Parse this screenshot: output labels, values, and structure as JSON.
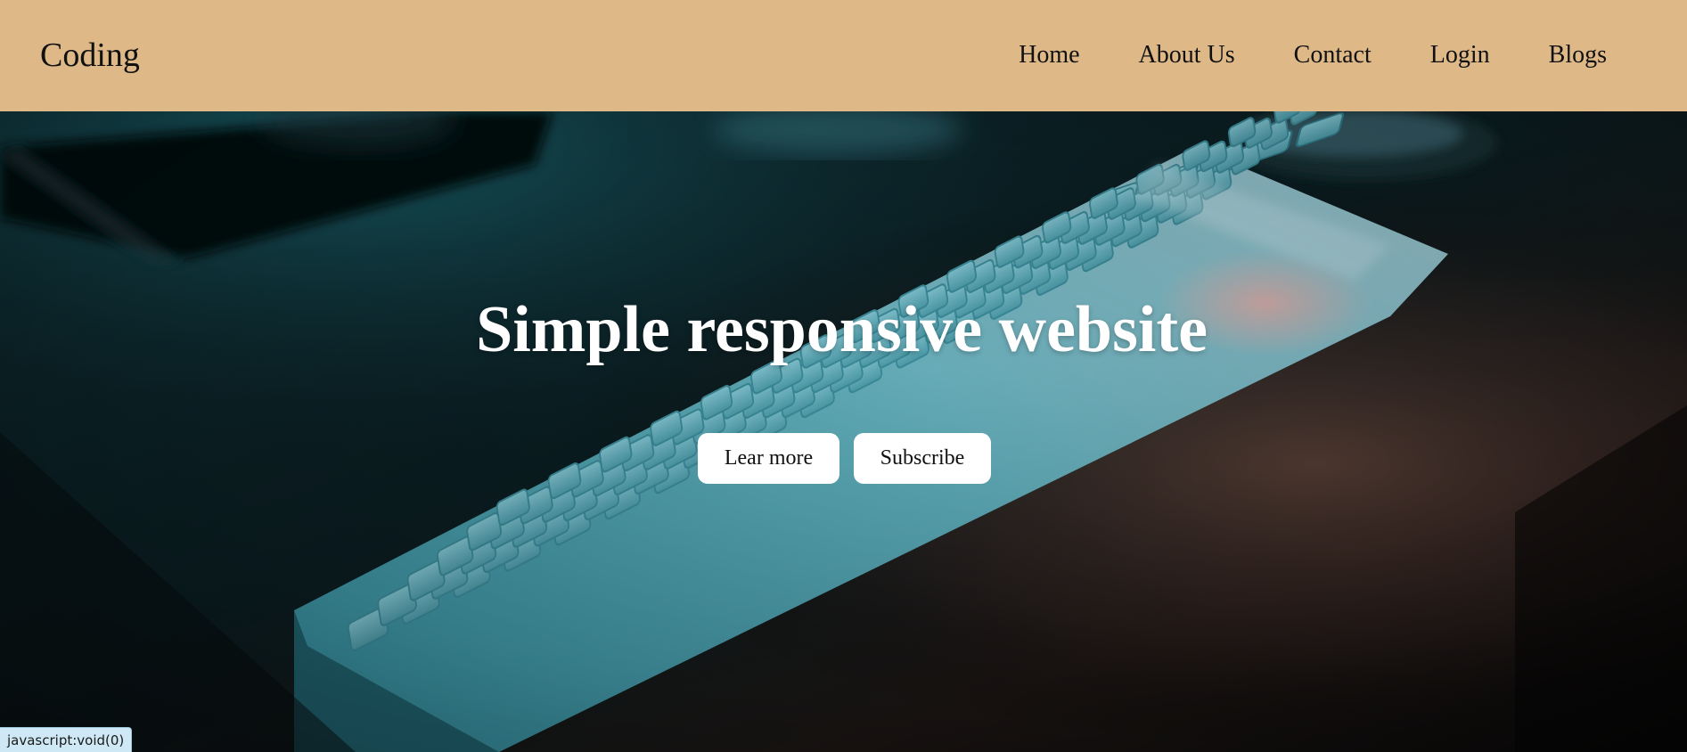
{
  "header": {
    "logo": "Coding",
    "nav": [
      {
        "label": "Home"
      },
      {
        "label": "About Us"
      },
      {
        "label": "Contact"
      },
      {
        "label": "Login"
      },
      {
        "label": "Blogs"
      }
    ]
  },
  "hero": {
    "title": "Simple responsive website",
    "buttons": {
      "learn_more": "Lear more",
      "subscribe": "Subscribe"
    }
  },
  "status_bar": {
    "url": "javascript:void(0)"
  },
  "colors": {
    "navbar_bg": "#deb887",
    "button_bg": "#ffffff",
    "title_text": "#ffffff",
    "status_bg": "#cfe8f5"
  },
  "icons": [
    "background-keyboard-image"
  ]
}
